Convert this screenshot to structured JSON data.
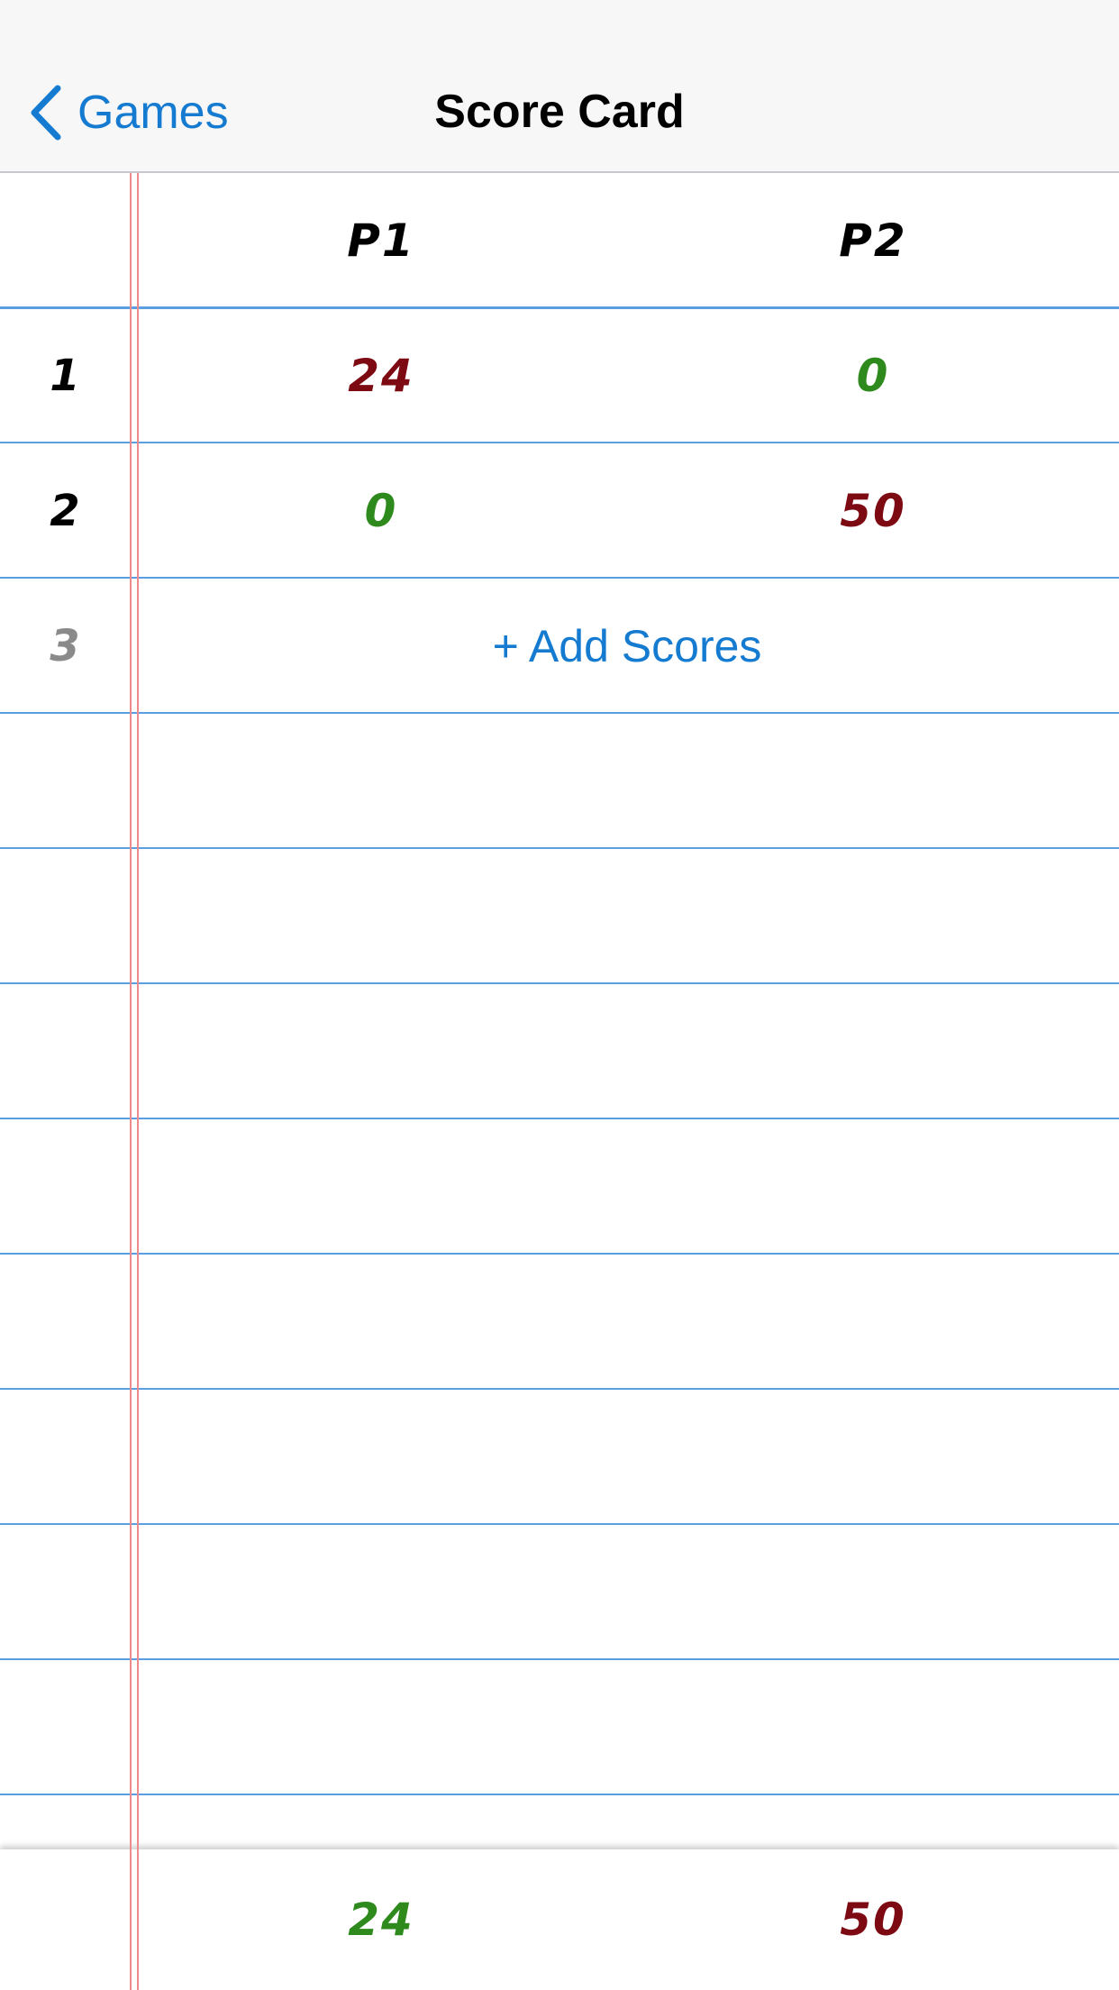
{
  "nav": {
    "back_label": "Games",
    "title": "Score Card"
  },
  "header": {
    "players": [
      "P1",
      "P2"
    ]
  },
  "rounds": [
    {
      "number": "1",
      "scores": [
        "24",
        "0"
      ]
    },
    {
      "number": "2",
      "scores": [
        "0",
        "50"
      ]
    }
  ],
  "pending_round": {
    "number": "3",
    "add_label": "+ Add Scores"
  },
  "totals": [
    "24",
    "50"
  ],
  "colors": {
    "accent": "#147bd1",
    "win_green": "#2e8a1c",
    "lose_red": "#7d0a12",
    "rule_blue": "#5b9fe0",
    "margin_red": "#ee8c8c"
  }
}
